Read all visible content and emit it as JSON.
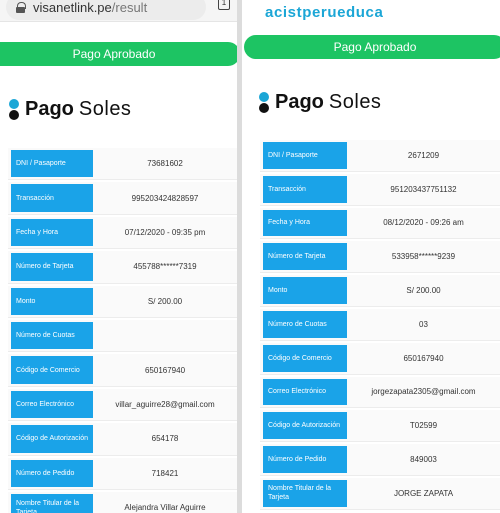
{
  "left": {
    "url": {
      "host": "visanetlink.pe",
      "path": "/result"
    },
    "tab_count": "1",
    "status_button": "Pago Aprobado",
    "logo": {
      "word1": "Pago",
      "word2": "Soles"
    },
    "rows": [
      {
        "label": "DNI / Pasaporte",
        "value": "73681602"
      },
      {
        "label": "Transacción",
        "value": "995203424828597"
      },
      {
        "label": "Fecha y Hora",
        "value": "07/12/2020 - 09:35 pm"
      },
      {
        "label": "Número de Tarjeta",
        "value": "455788******7319"
      },
      {
        "label": "Monto",
        "value": "S/ 200.00"
      },
      {
        "label": "Número de Cuotas",
        "value": ""
      },
      {
        "label": "Código de Comercio",
        "value": "650167940"
      },
      {
        "label": "Correo Electrónico",
        "value": "villar_aguirre28@gmail.com"
      },
      {
        "label": "Código de Autorización",
        "value": "654178"
      },
      {
        "label": "Número de Pedido",
        "value": "718421"
      },
      {
        "label": "Nombre Titular de la Tarjeta",
        "value": "Alejandra Villar Aguirre"
      }
    ]
  },
  "right": {
    "brand": "acistperueduca",
    "status_button": "Pago Aprobado",
    "logo": {
      "word1": "Pago",
      "word2": "Soles"
    },
    "rows": [
      {
        "label": "DNI / Pasaporte",
        "value": "2671209"
      },
      {
        "label": "Transacción",
        "value": "951203437751132"
      },
      {
        "label": "Fecha y Hora",
        "value": "08/12/2020 - 09:26 am"
      },
      {
        "label": "Número de Tarjeta",
        "value": "533958******9239"
      },
      {
        "label": "Monto",
        "value": "S/ 200.00"
      },
      {
        "label": "Número de Cuotas",
        "value": "03"
      },
      {
        "label": "Código de Comercio",
        "value": "650167940"
      },
      {
        "label": "Correo Electrónico",
        "value": "jorgezapata2305@gmail.com"
      },
      {
        "label": "Código de Autorización",
        "value": "T02599"
      },
      {
        "label": "Número de Pedido",
        "value": "849003"
      },
      {
        "label": "Nombre Titular de la Tarjeta",
        "value": "JORGE ZAPATA"
      }
    ]
  },
  "colors": {
    "accent_blue": "#1aa3e8",
    "approved_green": "#1dc463",
    "brand_blue": "#1ba6d6"
  }
}
